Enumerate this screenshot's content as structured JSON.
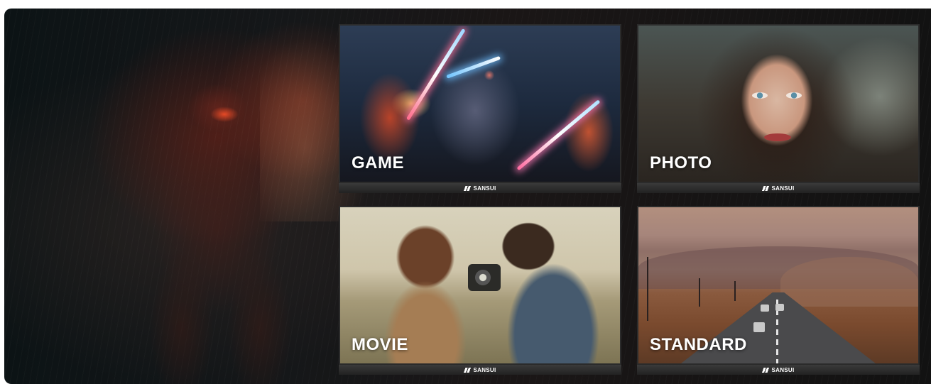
{
  "modes": [
    {
      "label": "GAME"
    },
    {
      "label": "PHOTO"
    },
    {
      "label": "MOVIE"
    },
    {
      "label": "STANDARD"
    }
  ],
  "brand": {
    "label": "SANSUI"
  },
  "colors": {
    "background": "#121416",
    "label_text": "#ffffff",
    "bezel": "#2a2a2a"
  }
}
